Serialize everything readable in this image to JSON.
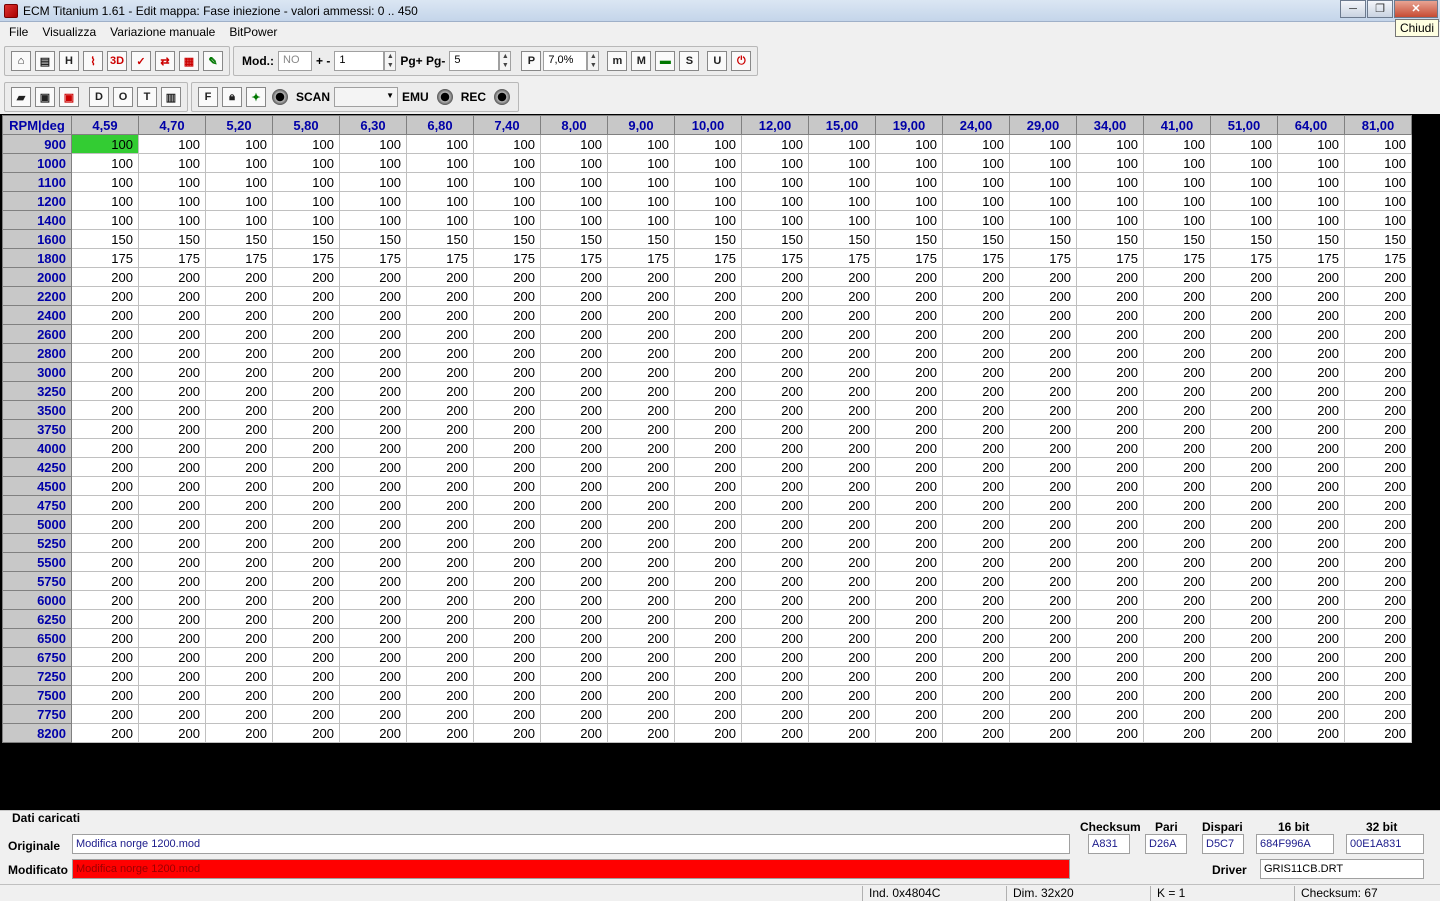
{
  "window": {
    "title": "ECM Titanium 1.61 - Edit mappa: Fase iniezione - valori ammessi: 0 .. 450",
    "minimize": "─",
    "maximize": "❐",
    "close": "✕",
    "close_tooltip": "Chiudi"
  },
  "menu": [
    "File",
    "Visualizza",
    "Variazione manuale",
    "BitPower"
  ],
  "toolbar1": {
    "mod_label": "Mod.:",
    "mod_value": "NO",
    "plusminus_label": "+ -",
    "step_value": "1",
    "pg_label": "Pg+ Pg-",
    "pg_value": "5",
    "percent_value": "7,0%"
  },
  "toolbar2": {
    "scan_label": "SCAN",
    "emu_label": "EMU",
    "rec_label": "REC"
  },
  "grid": {
    "corner": "RPM|deg",
    "columns": [
      "4,59",
      "4,70",
      "5,20",
      "5,80",
      "6,30",
      "6,80",
      "7,40",
      "8,00",
      "9,00",
      "10,00",
      "12,00",
      "15,00",
      "19,00",
      "24,00",
      "29,00",
      "34,00",
      "41,00",
      "51,00",
      "64,00",
      "81,00"
    ],
    "rows": [
      {
        "rpm": "900",
        "v": "100"
      },
      {
        "rpm": "1000",
        "v": "100"
      },
      {
        "rpm": "1100",
        "v": "100"
      },
      {
        "rpm": "1200",
        "v": "100"
      },
      {
        "rpm": "1400",
        "v": "100"
      },
      {
        "rpm": "1600",
        "v": "150"
      },
      {
        "rpm": "1800",
        "v": "175"
      },
      {
        "rpm": "2000",
        "v": "200"
      },
      {
        "rpm": "2200",
        "v": "200"
      },
      {
        "rpm": "2400",
        "v": "200"
      },
      {
        "rpm": "2600",
        "v": "200"
      },
      {
        "rpm": "2800",
        "v": "200"
      },
      {
        "rpm": "3000",
        "v": "200"
      },
      {
        "rpm": "3250",
        "v": "200"
      },
      {
        "rpm": "3500",
        "v": "200"
      },
      {
        "rpm": "3750",
        "v": "200"
      },
      {
        "rpm": "4000",
        "v": "200"
      },
      {
        "rpm": "4250",
        "v": "200"
      },
      {
        "rpm": "4500",
        "v": "200"
      },
      {
        "rpm": "4750",
        "v": "200"
      },
      {
        "rpm": "5000",
        "v": "200"
      },
      {
        "rpm": "5250",
        "v": "200"
      },
      {
        "rpm": "5500",
        "v": "200"
      },
      {
        "rpm": "5750",
        "v": "200"
      },
      {
        "rpm": "6000",
        "v": "200"
      },
      {
        "rpm": "6250",
        "v": "200"
      },
      {
        "rpm": "6500",
        "v": "200"
      },
      {
        "rpm": "6750",
        "v": "200"
      },
      {
        "rpm": "7250",
        "v": "200"
      },
      {
        "rpm": "7500",
        "v": "200"
      },
      {
        "rpm": "7750",
        "v": "200"
      },
      {
        "rpm": "8200",
        "v": "200"
      }
    ]
  },
  "loaded": {
    "title": "Dati caricati",
    "original_label": "Originale",
    "original_file": "Modifica norge 1200.mod",
    "modified_label": "Modificato",
    "modified_file": "Modifica norge 1200.mod",
    "checksum_label": "Checksum",
    "pari_label": "Pari",
    "dispari_label": "Dispari",
    "bit16_label": "16 bit",
    "bit32_label": "32 bit",
    "checksum": "A831",
    "pari": "D26A",
    "dispari": "D5C7",
    "bit16": "684F996A",
    "bit32": "00E1A831",
    "driver_label": "Driver",
    "driver": "GRIS11CB.DRT"
  },
  "status": {
    "ind": "Ind. 0x4804C",
    "dim": "Dim. 32x20",
    "k": "K = 1",
    "checksum": "Checksum: 67"
  },
  "colors": {
    "selected_cell": "#33cc33",
    "header_text": "#0000a8",
    "modified_bg": "#ff0000"
  }
}
